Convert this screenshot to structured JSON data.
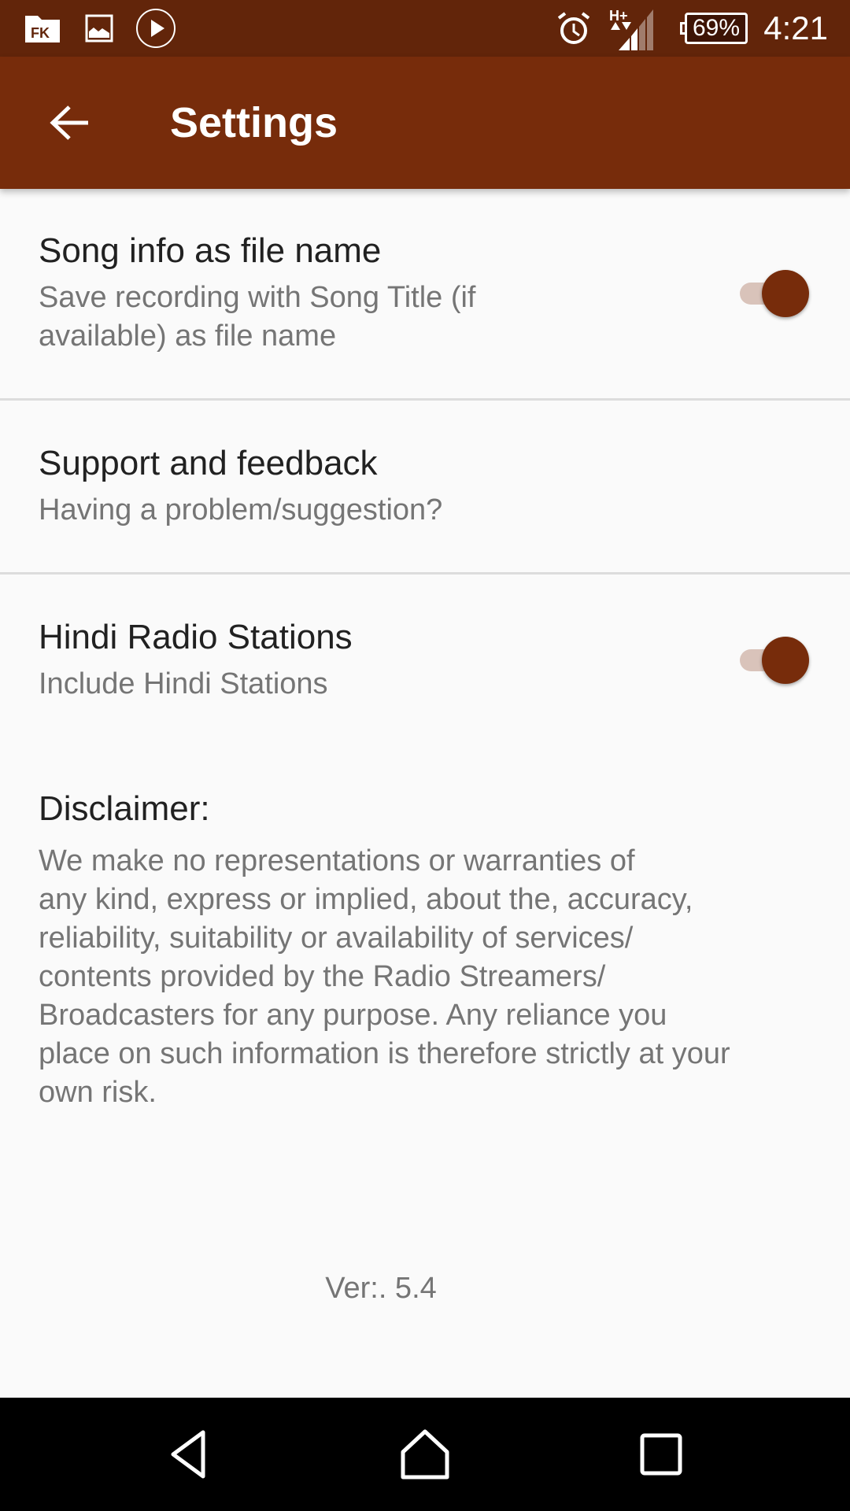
{
  "status_bar": {
    "left_icons": [
      "file-manager-fk-icon",
      "image-icon",
      "play-circle-icon"
    ],
    "right_icons": [
      "alarm-icon",
      "network-hplus-icon",
      "signal-icon",
      "battery-icon"
    ],
    "network_type": "H+",
    "battery_percent": "69%",
    "time": "4:21"
  },
  "app_bar": {
    "back_icon": "arrow-back-icon",
    "title": "Settings",
    "color": "#772C0B"
  },
  "settings": [
    {
      "title": "Song info as file name",
      "subtitle_lines": [
        "Save recording with Song Title (if",
        "available) as file name"
      ],
      "has_switch": true,
      "switch_on": true
    },
    {
      "title": "Support and feedback",
      "subtitle_lines": [
        "Having a problem/suggestion?"
      ],
      "has_switch": false
    },
    {
      "title": "Hindi Radio Stations",
      "subtitle_lines": [
        "Include Hindi Stations"
      ],
      "has_switch": true,
      "switch_on": true
    }
  ],
  "disclaimer": {
    "title": "Disclaimer:",
    "lines": [
      "We make no representations or warranties of",
      "any kind, express or implied, about the, accuracy,",
      "reliability, suitability or availability of services/",
      "contents provided by the Radio Streamers/",
      "Broadcasters for any purpose. Any reliance you",
      "place on such information is therefore strictly at your",
      "own risk."
    ]
  },
  "version": "Ver:. 5.4",
  "nav_bar": {
    "back": "nav-back-icon",
    "home": "nav-home-icon",
    "recents": "nav-recents-icon"
  },
  "colors": {
    "status_bar": "#62250A",
    "accent": "#772C0B",
    "switch_track": "#D9C3BA",
    "background": "#FAFAFA"
  }
}
